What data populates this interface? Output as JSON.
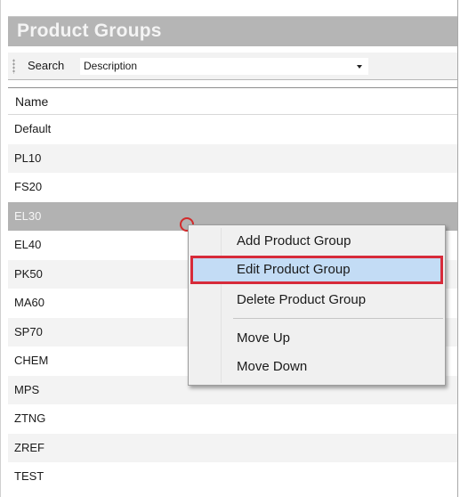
{
  "panel": {
    "title": "Product Groups"
  },
  "toolbar": {
    "search_label": "Search",
    "search_field_value": "Description"
  },
  "grid": {
    "column_header": "Name",
    "rows": [
      {
        "name": "Default"
      },
      {
        "name": "PL10"
      },
      {
        "name": "FS20"
      },
      {
        "name": "EL30"
      },
      {
        "name": "EL40"
      },
      {
        "name": "PK50"
      },
      {
        "name": "MA60"
      },
      {
        "name": "SP70"
      },
      {
        "name": "CHEM"
      },
      {
        "name": "MPS"
      },
      {
        "name": "ZTNG"
      },
      {
        "name": "ZREF"
      },
      {
        "name": "TEST"
      }
    ],
    "selected_row": "EL30"
  },
  "context_menu": {
    "items": [
      {
        "label": "Add Product Group"
      },
      {
        "label": "Edit Product Group"
      },
      {
        "label": "Delete Product Group"
      },
      {
        "label": "Move Up"
      },
      {
        "label": "Move Down"
      }
    ],
    "highlighted_item": "Edit Product Group"
  },
  "colors": {
    "title_bar": "#b5b5b5",
    "selected_row": "#b2b2b2",
    "menu_highlight": "#c3dcf5",
    "annotation_red": "#d72b3a"
  }
}
